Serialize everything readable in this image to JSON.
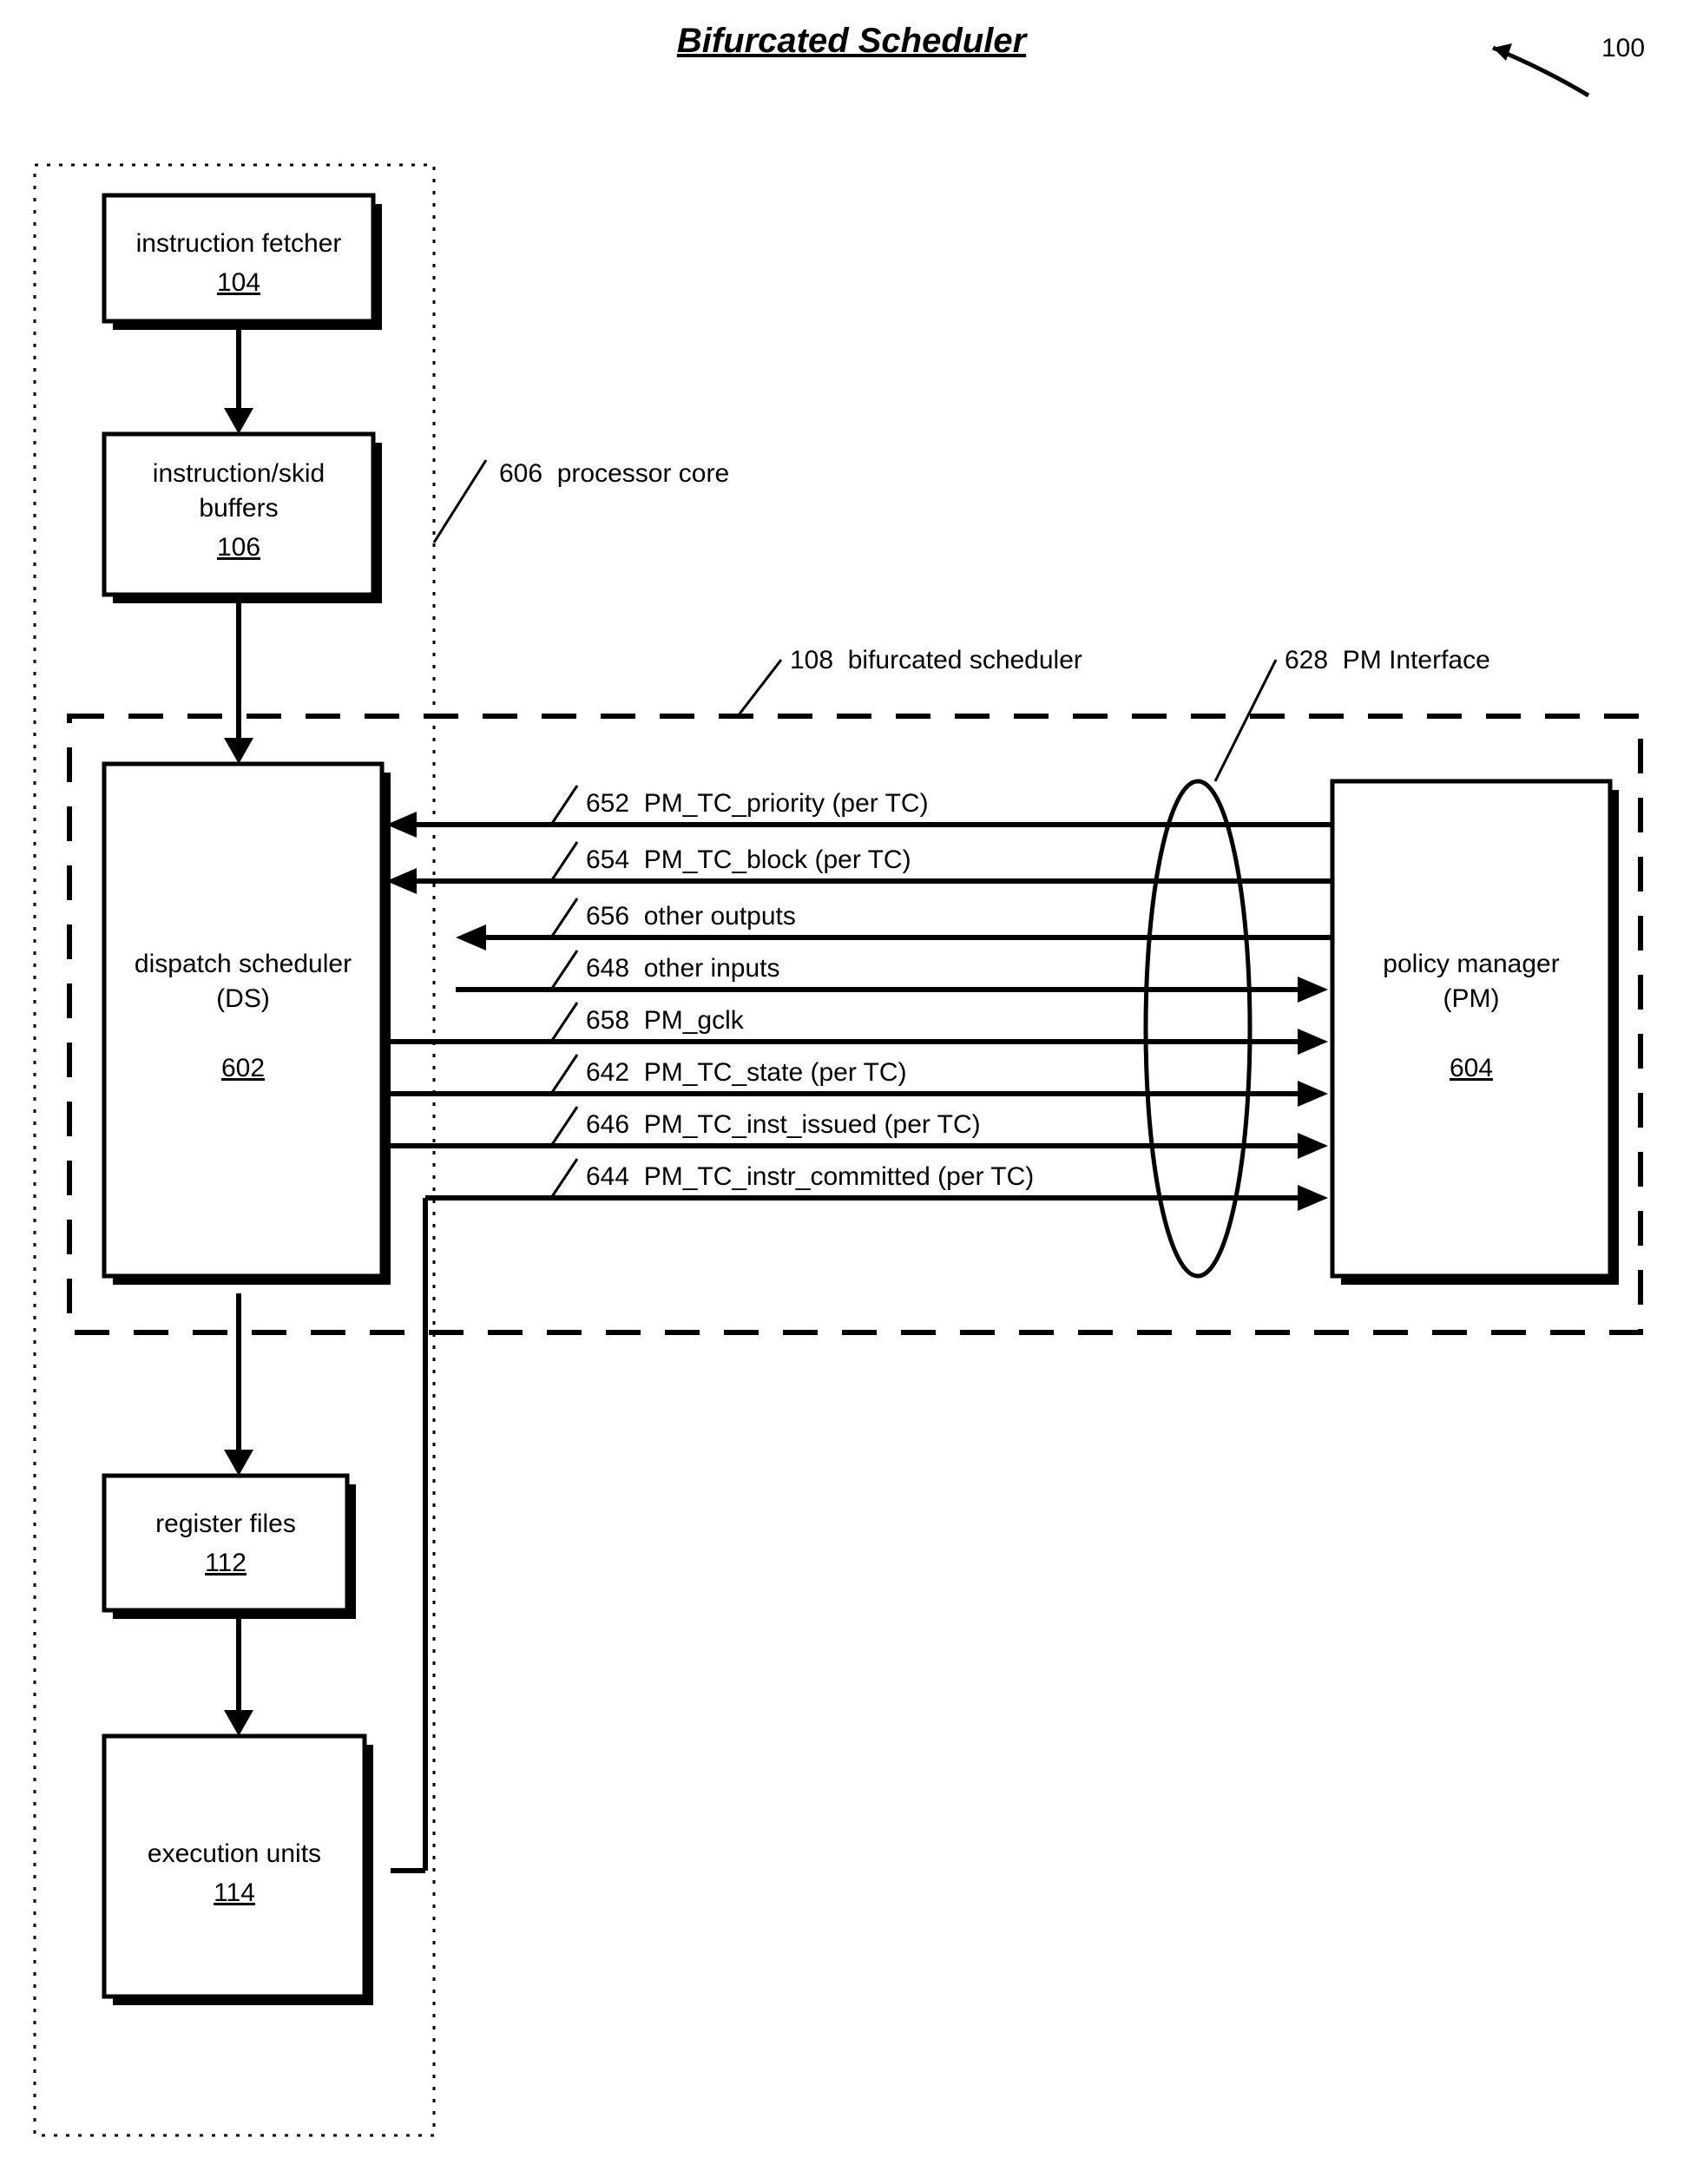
{
  "title": "Bifurcated Scheduler",
  "figureRef": "100",
  "coreLabel": {
    "num": "606",
    "txt": "processor core"
  },
  "schedLabel": {
    "num": "108",
    "txt": "bifurcated scheduler"
  },
  "pmIfaceLabel": {
    "num": "628",
    "txt": "PM Interface"
  },
  "blocks": {
    "fetcher": {
      "line1": "instruction fetcher",
      "num": "104"
    },
    "buffers": {
      "line1": "instruction/skid",
      "line2": "buffers",
      "num": "106"
    },
    "ds": {
      "line1": "dispatch scheduler",
      "line2": "(DS)",
      "num": "602"
    },
    "pm": {
      "line1": "policy manager",
      "line2": "(PM)",
      "num": "604"
    },
    "regs": {
      "line1": "register files",
      "num": "112"
    },
    "exec": {
      "line1": "execution units",
      "num": "114"
    }
  },
  "signals": {
    "s652": {
      "num": "652",
      "txt": "PM_TC_priority (per TC)"
    },
    "s654": {
      "num": "654",
      "txt": "PM_TC_block (per TC)"
    },
    "s656": {
      "num": "656",
      "txt": "other outputs"
    },
    "s648": {
      "num": "648",
      "txt": "other inputs"
    },
    "s658": {
      "num": "658",
      "txt": "PM_gclk"
    },
    "s642": {
      "num": "642",
      "txt": "PM_TC_state (per TC)"
    },
    "s646": {
      "num": "646",
      "txt": "PM_TC_inst_issued (per TC)"
    },
    "s644": {
      "num": "644",
      "txt": "PM_TC_instr_committed (per TC)"
    }
  }
}
